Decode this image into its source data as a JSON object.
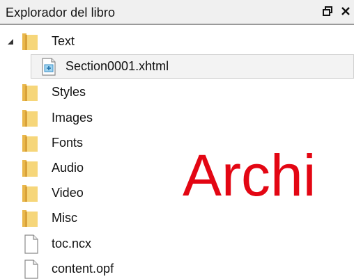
{
  "panel": {
    "title": "Explorador del libro",
    "restore_icon": "restore-window-icon",
    "close_icon": "close-icon"
  },
  "tree": {
    "items": [
      {
        "label": "Text",
        "type": "folder",
        "expanded": true,
        "level": 0
      },
      {
        "label": "Section0001.xhtml",
        "type": "xhtml-file",
        "selected": true,
        "level": 1
      },
      {
        "label": "Styles",
        "type": "folder",
        "level": 0
      },
      {
        "label": "Images",
        "type": "folder",
        "level": 0
      },
      {
        "label": "Fonts",
        "type": "folder",
        "level": 0
      },
      {
        "label": "Audio",
        "type": "folder",
        "level": 0
      },
      {
        "label": "Video",
        "type": "folder",
        "level": 0
      },
      {
        "label": "Misc",
        "type": "folder",
        "level": 0
      },
      {
        "label": "toc.ncx",
        "type": "file",
        "level": 0
      },
      {
        "label": "content.opf",
        "type": "file",
        "level": 0
      }
    ]
  },
  "overlay": {
    "text": "Archi",
    "color": "#e30613"
  }
}
